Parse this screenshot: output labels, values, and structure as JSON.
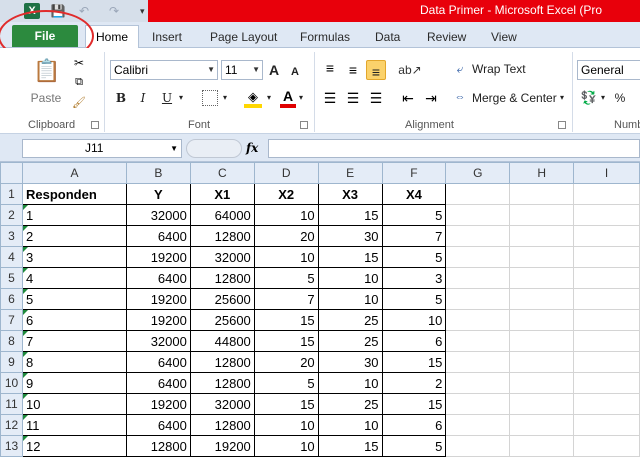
{
  "app": {
    "title": "Data Primer  -  Microsoft Excel (Pro",
    "logo": "X"
  },
  "quick_access": {
    "save_icon": "💾",
    "undo_icon": "↶",
    "redo_icon": "↷",
    "more_icon": "▾"
  },
  "tabs": [
    {
      "label": "File"
    },
    {
      "label": "Home"
    },
    {
      "label": "Insert"
    },
    {
      "label": "Page Layout"
    },
    {
      "label": "Formulas"
    },
    {
      "label": "Data"
    },
    {
      "label": "Review"
    },
    {
      "label": "View"
    }
  ],
  "ribbon": {
    "clipboard": {
      "paste": "Paste",
      "label": "Clipboard"
    },
    "font": {
      "name": "Calibri",
      "size": "11",
      "grow": "A",
      "shrink": "A",
      "bold": "B",
      "italic": "I",
      "underline": "U",
      "label": "Font"
    },
    "alignment": {
      "wrap_text": "Wrap Text",
      "merge_center": "Merge & Center",
      "label": "Alignment"
    },
    "number": {
      "format": "General",
      "percent": "%",
      "label": "Numb"
    }
  },
  "formula_bar": {
    "cell_ref": "J11",
    "fx": "fx",
    "formula": ""
  },
  "columns": [
    "A",
    "B",
    "C",
    "D",
    "E",
    "F",
    "G",
    "H",
    "I"
  ],
  "rows": [
    {
      "n": "1",
      "cells": [
        "Responden",
        "Y",
        "X1",
        "X2",
        "X3",
        "X4"
      ]
    },
    {
      "n": "2",
      "cells": [
        "1",
        "32000",
        "64000",
        "10",
        "15",
        "5"
      ]
    },
    {
      "n": "3",
      "cells": [
        "2",
        "6400",
        "12800",
        "20",
        "30",
        "7"
      ]
    },
    {
      "n": "4",
      "cells": [
        "3",
        "19200",
        "32000",
        "10",
        "15",
        "5"
      ]
    },
    {
      "n": "5",
      "cells": [
        "4",
        "6400",
        "12800",
        "5",
        "10",
        "3"
      ]
    },
    {
      "n": "6",
      "cells": [
        "5",
        "19200",
        "25600",
        "7",
        "10",
        "5"
      ]
    },
    {
      "n": "7",
      "cells": [
        "6",
        "19200",
        "25600",
        "15",
        "25",
        "10"
      ]
    },
    {
      "n": "8",
      "cells": [
        "7",
        "32000",
        "44800",
        "15",
        "25",
        "6"
      ]
    },
    {
      "n": "9",
      "cells": [
        "8",
        "6400",
        "12800",
        "20",
        "30",
        "15"
      ]
    },
    {
      "n": "10",
      "cells": [
        "9",
        "6400",
        "12800",
        "5",
        "10",
        "2"
      ]
    },
    {
      "n": "11",
      "cells": [
        "10",
        "19200",
        "32000",
        "15",
        "25",
        "15"
      ]
    },
    {
      "n": "12",
      "cells": [
        "11",
        "6400",
        "12800",
        "10",
        "10",
        "6"
      ]
    },
    {
      "n": "13",
      "cells": [
        "12",
        "12800",
        "19200",
        "10",
        "15",
        "5"
      ]
    }
  ],
  "colors": {
    "file_tab": "#2c8a3e",
    "title_bar": "#e8000b",
    "annotation": "#e02b2b"
  }
}
